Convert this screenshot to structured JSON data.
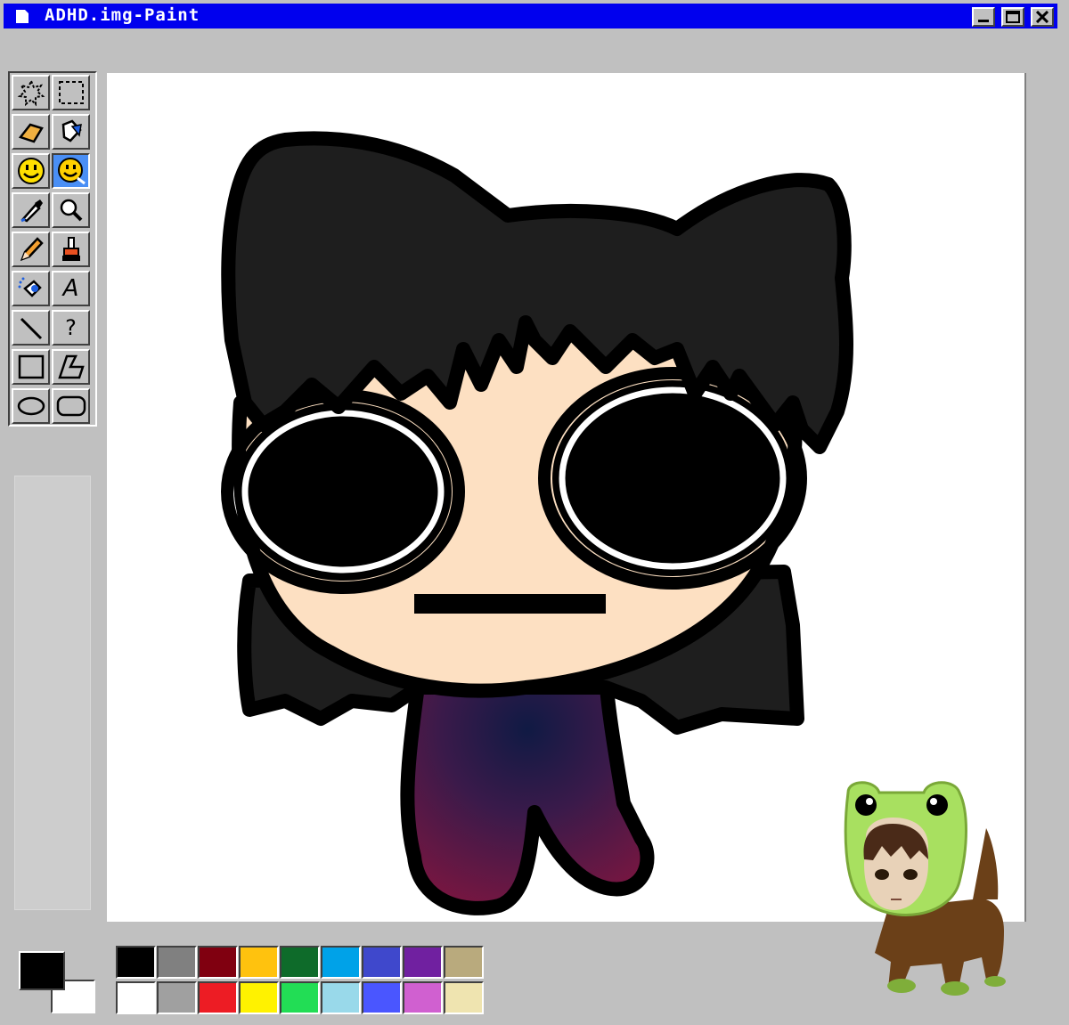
{
  "window": {
    "title": "ADHD.img-Paint",
    "buttons": [
      "minimize",
      "maximize",
      "close"
    ]
  },
  "toolbox": {
    "tools": [
      {
        "name": "free-select",
        "icon": "star-select-icon"
      },
      {
        "name": "select",
        "icon": "rect-select-icon"
      },
      {
        "name": "eraser",
        "icon": "eraser-icon"
      },
      {
        "name": "fill",
        "icon": "fill-bucket-icon"
      },
      {
        "name": "smiley",
        "icon": "smiley-icon"
      },
      {
        "name": "smiley-alt",
        "icon": "smiley-sticker-icon",
        "active": true
      },
      {
        "name": "color-picker",
        "icon": "eyedropper-icon"
      },
      {
        "name": "magnifier",
        "icon": "magnifier-icon"
      },
      {
        "name": "pencil",
        "icon": "pencil-icon"
      },
      {
        "name": "brush",
        "icon": "brush-icon"
      },
      {
        "name": "airbrush",
        "icon": "airbrush-icon"
      },
      {
        "name": "text",
        "icon": "text-icon",
        "glyph": "A"
      },
      {
        "name": "line",
        "icon": "line-icon"
      },
      {
        "name": "curve",
        "icon": "curve-icon",
        "glyph": "?"
      },
      {
        "name": "rectangle",
        "icon": "rectangle-icon"
      },
      {
        "name": "polygon",
        "icon": "polygon-icon"
      },
      {
        "name": "ellipse",
        "icon": "ellipse-icon"
      },
      {
        "name": "rounded-rectangle",
        "icon": "rounded-rect-icon"
      }
    ]
  },
  "colors": {
    "foreground": "#000000",
    "background": "#ffffff",
    "palette_top": [
      "#000000",
      "#808080",
      "#800010",
      "#ffc20e",
      "#0e6b2a",
      "#00a2e8",
      "#3f48cc",
      "#7020a0",
      "#b9aa7d"
    ],
    "palette_bottom": [
      "#ffffff",
      "#a0a0a0",
      "#ed1c24",
      "#fff200",
      "#22dd55",
      "#99d9ea",
      "#4a56ff",
      "#d060d0",
      "#efe4b0"
    ]
  },
  "canvas": {
    "subject": "drawing",
    "hair_color": "#1e1e1e",
    "skin_color": "#fde0c2",
    "body_colors": [
      "#1a1a4a",
      "#5a1a48",
      "#7a1640"
    ]
  }
}
